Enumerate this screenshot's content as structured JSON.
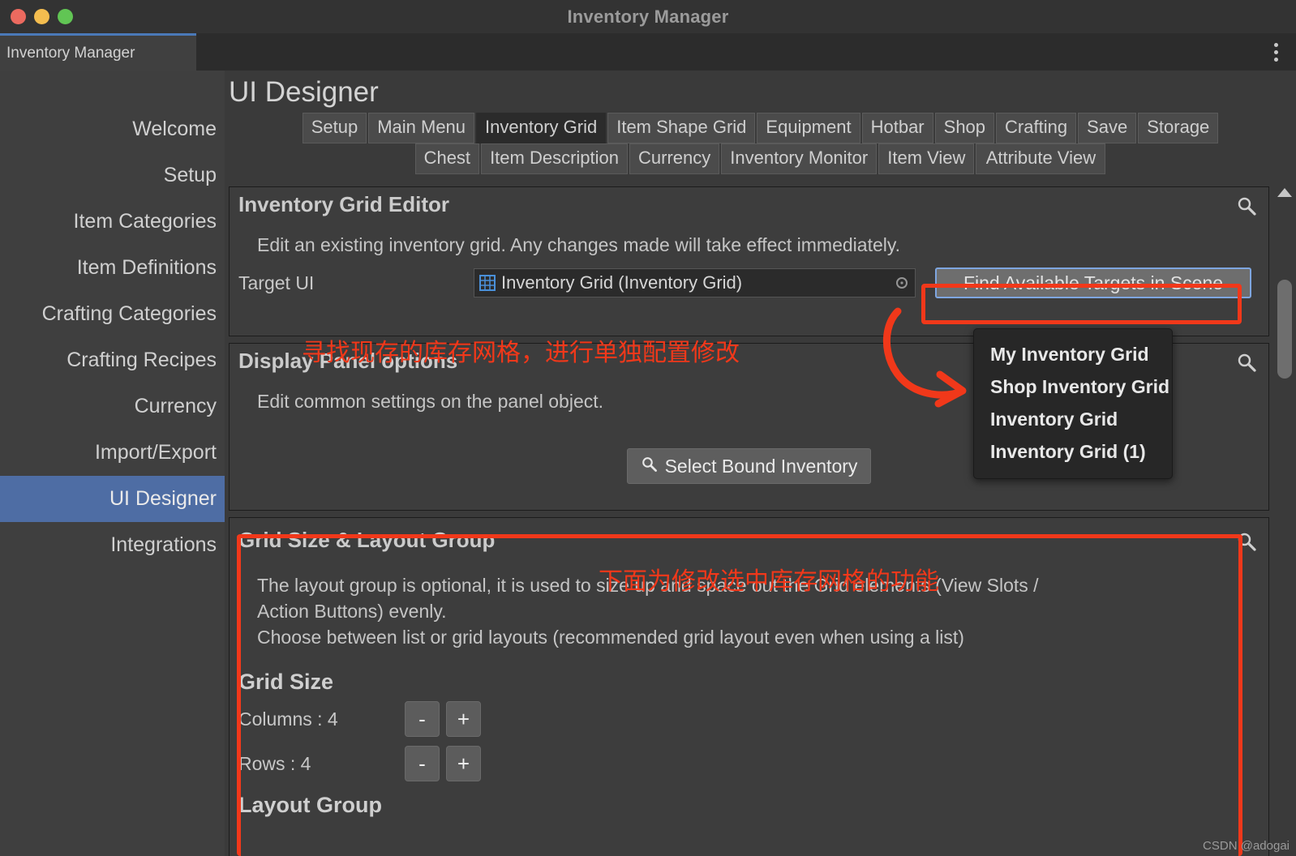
{
  "window": {
    "title": "Inventory Manager",
    "tab_label": "Inventory Manager",
    "menu_icon": "kebab-menu-icon"
  },
  "sidebar": {
    "items": [
      {
        "label": "Welcome",
        "active": false
      },
      {
        "label": "Setup",
        "active": false
      },
      {
        "label": "Item Categories",
        "active": false
      },
      {
        "label": "Item Definitions",
        "active": false
      },
      {
        "label": "Crafting Categories",
        "active": false
      },
      {
        "label": "Crafting Recipes",
        "active": false
      },
      {
        "label": "Currency",
        "active": false
      },
      {
        "label": "Import/Export",
        "active": false
      },
      {
        "label": "UI Designer",
        "active": true
      },
      {
        "label": "Integrations",
        "active": false
      }
    ]
  },
  "page": {
    "title": "UI Designer"
  },
  "tabs": {
    "row1": [
      {
        "label": "Setup",
        "selected": false
      },
      {
        "label": "Main Menu",
        "selected": false
      },
      {
        "label": "Inventory Grid",
        "selected": true
      },
      {
        "label": "Item Shape Grid",
        "selected": false
      },
      {
        "label": "Equipment",
        "selected": false
      },
      {
        "label": "Hotbar",
        "selected": false
      },
      {
        "label": "Shop",
        "selected": false
      },
      {
        "label": "Crafting",
        "selected": false
      },
      {
        "label": "Save",
        "selected": false
      },
      {
        "label": "Storage",
        "selected": false
      }
    ],
    "row2": [
      {
        "label": "Chest",
        "selected": false
      },
      {
        "label": "Item Description",
        "selected": false
      },
      {
        "label": "Currency",
        "selected": false
      },
      {
        "label": "Inventory Monitor",
        "selected": false
      },
      {
        "label": "Item View",
        "selected": false
      },
      {
        "label": "Attribute View",
        "selected": false
      }
    ]
  },
  "editor_panel": {
    "title": "Inventory Grid Editor",
    "description": "Edit an existing inventory grid. Any changes made will take effect immediately.",
    "target_label": "Target UI",
    "target_value": "Inventory Grid (Inventory Grid)",
    "target_icon": "grid-object-icon",
    "picker_icon": "object-picker-icon",
    "find_button": "Find Available Targets in Scene",
    "search_icon": "search-icon"
  },
  "dropdown": {
    "items": [
      "My Inventory Grid",
      "Shop Inventory Grid",
      "Inventory Grid",
      "Inventory Grid (1)"
    ]
  },
  "display_panel": {
    "title": "Display Panel options",
    "description": "Edit common settings on the panel object.",
    "button_label": "Select Bound Inventory",
    "button_icon": "search-icon",
    "search_icon": "search-icon"
  },
  "grid_panel": {
    "title": "Grid Size & Layout Group",
    "description_line1": "The layout group is optional, it is used to size up and space out the Grid elements (View Slots /",
    "description_line2": "Action Buttons) evenly.",
    "description_line3": "Choose between list or grid layouts (recommended grid layout even when using a list)",
    "grid_size_heading": "Grid Size",
    "columns_label": "Columns : 4",
    "rows_label": "Rows : 4",
    "minus_label": "-",
    "plus_label": "+",
    "layout_group_heading": "Layout Group",
    "search_icon": "search-icon"
  },
  "annotations": {
    "note_top": "寻找现存的库存网格，进行单独配置修改",
    "note_bottom": "下面为修改选中库存网格的功能",
    "accent_color": "#f1381a"
  },
  "scrollbar": {
    "up_arrow_icon": "chevron-up-icon"
  },
  "watermark": "CSDN @adogai"
}
